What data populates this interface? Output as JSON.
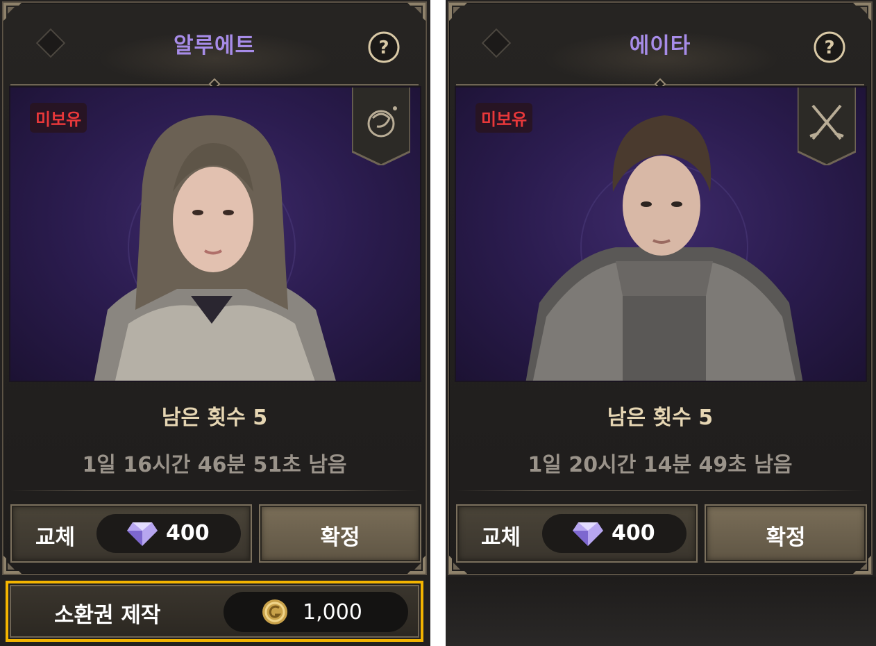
{
  "cards": [
    {
      "name": "알루에트",
      "status_badge": "미보유",
      "class_icon": "orb-spiral-icon",
      "remaining_count": "남은 횟수 5",
      "time_left": "1일 16시간 46분 51초 남음",
      "swap_label": "교체",
      "swap_cost": "400",
      "confirm_label": "확정"
    },
    {
      "name": "에이타",
      "status_badge": "미보유",
      "class_icon": "crossed-swords-icon",
      "remaining_count": "남은 횟수 5",
      "time_left": "1일 20시간 14분 49초 남음",
      "swap_label": "교체",
      "swap_cost": "400",
      "confirm_label": "확정"
    }
  ],
  "craft": {
    "label": "소환권 제작",
    "cost": "1,000",
    "currency_icon": "gold-coin-icon"
  },
  "colors": {
    "title": "#a78ce8",
    "badge": "#e8383a",
    "highlight": "#f3b400",
    "remaining": "#e6d6b3",
    "timer": "#9a938a"
  }
}
